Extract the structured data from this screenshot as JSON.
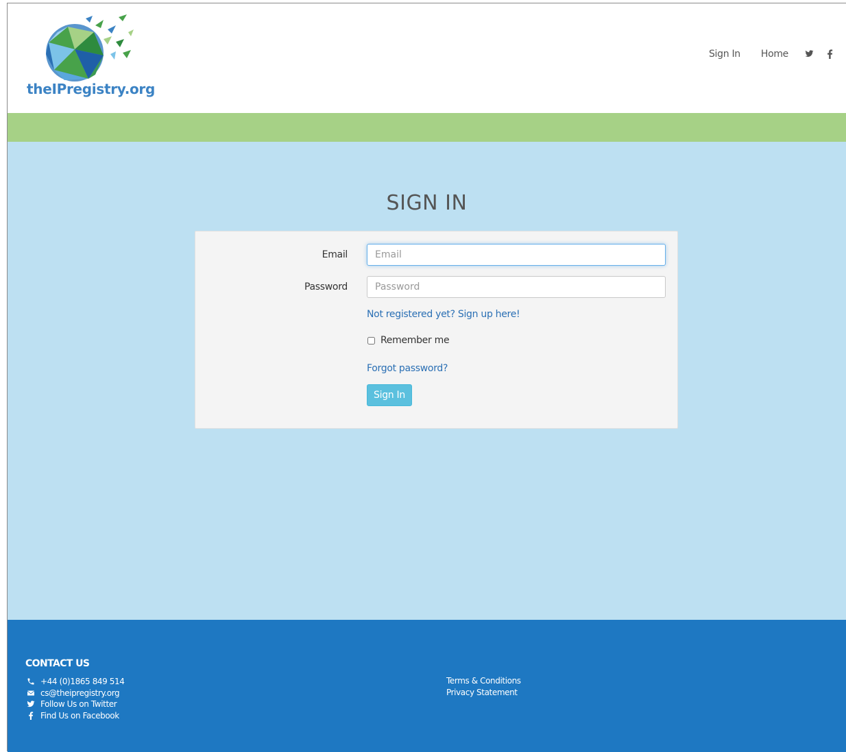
{
  "brand": {
    "name": "theIPregistry.org",
    "logo_colors": [
      "#3c83c4",
      "#48a24a",
      "#a6d186",
      "#1f5fa8"
    ]
  },
  "nav": {
    "items": [
      {
        "label": "Sign In"
      },
      {
        "label": "Home"
      }
    ],
    "social": [
      "twitter-icon",
      "facebook-icon"
    ]
  },
  "colors": {
    "green_bar": "#a6d186",
    "main_bg": "#bde0f2",
    "footer_bg": "#1e78c2",
    "button": "#5bc0de",
    "link": "#2a6fb4"
  },
  "page": {
    "title": "SIGN IN"
  },
  "form": {
    "email": {
      "label": "Email",
      "placeholder": "Email",
      "value": ""
    },
    "password": {
      "label": "Password",
      "placeholder": "Password",
      "value": ""
    },
    "register_link": "Not registered yet? Sign up here!",
    "remember_me": {
      "label": "Remember me",
      "checked": false
    },
    "forgot_link": "Forgot password?",
    "submit_label": "Sign In"
  },
  "footer": {
    "contact_title": "CONTACT US",
    "contacts": [
      {
        "icon": "phone-icon",
        "text": "+44 (0)1865 849 514"
      },
      {
        "icon": "envelope-icon",
        "text": "cs@theipregistry.org"
      },
      {
        "icon": "twitter-icon",
        "text": "Follow Us on Twitter"
      },
      {
        "icon": "facebook-icon",
        "text": "Find Us on Facebook"
      }
    ],
    "links": [
      {
        "text": "Terms & Conditions"
      },
      {
        "text": "Privacy Statement"
      }
    ]
  }
}
